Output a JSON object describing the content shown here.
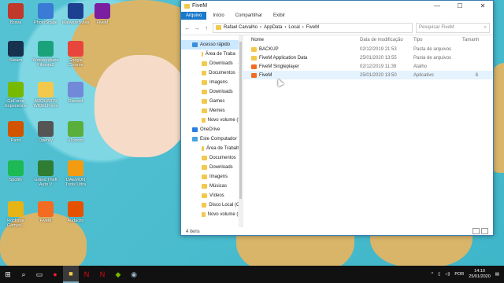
{
  "desktop": {
    "icons": [
      {
        "label": "Brava",
        "color": "#c0392b"
      },
      {
        "label": "PhotoScape",
        "color": "#3a7bd5"
      },
      {
        "label": "MalwareBytes",
        "color": "#1d3f8f"
      },
      {
        "label": "FiveM",
        "color": "#7a1fa2"
      },
      {
        "label": "Steam",
        "color": "#16324f"
      },
      {
        "label": "Wondershare Filmora9",
        "color": "#1aa37a"
      },
      {
        "label": "Google Chrome",
        "color": "#e8453c"
      },
      {
        "label": "GeForce Experience",
        "color": "#76b900"
      },
      {
        "label": "ARQUIVOS WIDELP.exe",
        "color": "#f2c94c"
      },
      {
        "label": "Discord",
        "color": "#7289da"
      },
      {
        "label": "Paint",
        "color": "#d35400"
      },
      {
        "label": "OpenIV",
        "color": "#555555"
      },
      {
        "label": "uTorrent",
        "color": "#5aaf3c"
      },
      {
        "label": "Spotify",
        "color": "#1db954"
      },
      {
        "label": "Grand Theft Auto V",
        "color": "#2e7d32"
      },
      {
        "label": "DAEMON Tools Ultra",
        "color": "#f39c12"
      },
      {
        "label": "Rockstar Games...",
        "color": "#e7b416"
      },
      {
        "label": "FiveM",
        "color": "#f36c21"
      },
      {
        "label": "Audacity",
        "color": "#e65100"
      }
    ]
  },
  "window": {
    "title": "FiveM",
    "ribbon_tabs": [
      "Arquivo",
      "Início",
      "Compartilhar",
      "Exibir"
    ],
    "controls": {
      "minimize": "—",
      "maximize": "☐",
      "close": "✕"
    },
    "breadcrumb": [
      "Rafael Carvalho",
      "AppData",
      "Local",
      "FiveM"
    ],
    "search_placeholder": "Pesquisar FiveM",
    "sidebar": [
      {
        "label": "Acesso rápido",
        "type": "star",
        "selected": true
      },
      {
        "label": "Área de Traba",
        "pin": true
      },
      {
        "label": "Downloads",
        "pin": true
      },
      {
        "label": "Documentos",
        "pin": true
      },
      {
        "label": "Imagens",
        "pin": true
      },
      {
        "label": "Downloads"
      },
      {
        "label": "Games"
      },
      {
        "label": "Memes"
      },
      {
        "label": "Novo volume (E:"
      },
      {
        "label": "OneDrive",
        "type": "cloud"
      },
      {
        "label": "Este Computador",
        "type": "pc"
      },
      {
        "label": "Área de Trabalho"
      },
      {
        "label": "Documentos"
      },
      {
        "label": "Downloads"
      },
      {
        "label": "Imagens"
      },
      {
        "label": "Músicas"
      },
      {
        "label": "Vídeos"
      },
      {
        "label": "Disco Local (C:)"
      },
      {
        "label": "Novo volume (E:"
      }
    ],
    "columns": {
      "name": "Nome",
      "date": "Data de modificação",
      "type": "Tipo",
      "size": "Tamanh"
    },
    "files": [
      {
        "name": "BACKUP",
        "date": "02/12/2019 21:53",
        "type": "Pasta de arquivos",
        "size": "",
        "kind": "folder"
      },
      {
        "name": "FiveM Application Data",
        "date": "25/01/2020 13:55",
        "type": "Pasta de arquivos",
        "size": "",
        "kind": "folder"
      },
      {
        "name": "FiveM Singleplayer",
        "date": "02/12/2019 11:39",
        "type": "Atalho",
        "size": "",
        "kind": "shortcut"
      },
      {
        "name": "FiveM",
        "date": "25/01/2020 13:50",
        "type": "Aplicativo",
        "size": "8",
        "kind": "app",
        "selected": true
      }
    ],
    "status": "4 itens"
  },
  "taskbar": {
    "lang": "POR",
    "time": "14:10",
    "date": "25/01/2020"
  }
}
